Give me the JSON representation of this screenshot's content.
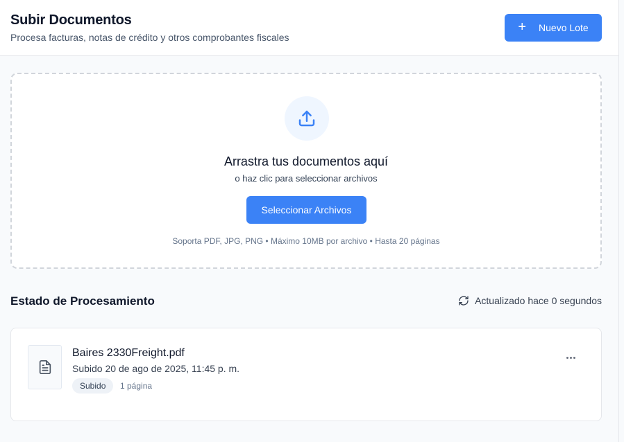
{
  "header": {
    "title": "Subir Documentos",
    "subtitle": "Procesa facturas, notas de crédito y otros comprobantes fiscales",
    "new_batch_label": "Nuevo Lote"
  },
  "dropzone": {
    "title": "Arrastra tus documentos aquí",
    "subtitle": "o haz clic para seleccionar archivos",
    "button_label": "Seleccionar Archivos",
    "note": "Soporta PDF, JPG, PNG • Máximo 10MB por archivo • Hasta 20 páginas"
  },
  "processing": {
    "title": "Estado de Procesamiento",
    "refresh_text": "Actualizado hace 0 segundos",
    "documents": [
      {
        "name": "Baires 2330Freight.pdf",
        "uploaded": "Subido 20 de ago de 2025, 11:45 p. m.",
        "status": "Subido",
        "pages": "1 página"
      }
    ]
  },
  "icons": {
    "new_batch": "plus-icon",
    "upload": "upload-icon",
    "refresh": "refresh-icon",
    "document": "file-text-icon",
    "more": "more-horizontal-icon"
  },
  "colors": {
    "primary": "#3b82f6",
    "upload_circle_bg": "#eff6ff"
  }
}
